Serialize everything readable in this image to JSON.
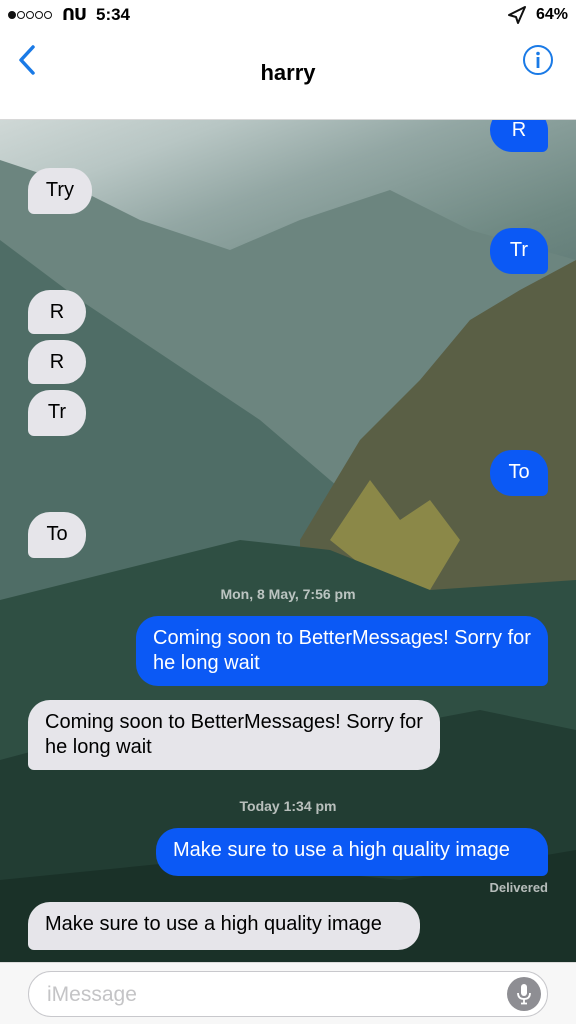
{
  "status_bar": {
    "carrier": "ᑎᑌ",
    "time": "5:34",
    "battery": "64%"
  },
  "nav": {
    "contact_name": "harry"
  },
  "messages": [
    {
      "text": "R",
      "dir": "out"
    },
    {
      "text": "Try",
      "dir": "in"
    },
    {
      "text": "Tr",
      "dir": "out"
    },
    {
      "text": "R",
      "dir": "in"
    },
    {
      "text": "R",
      "dir": "in"
    },
    {
      "text": "Tr",
      "dir": "in"
    },
    {
      "text": "To",
      "dir": "out"
    },
    {
      "text": "To",
      "dir": "in"
    },
    {
      "text": "Coming soon to BetterMessages! Sorry for he long wait",
      "dir": "out"
    },
    {
      "text": "Coming soon to BetterMessages! Sorry for he long wait",
      "dir": "in"
    },
    {
      "text": "Make sure to use a high quality image",
      "dir": "out"
    },
    {
      "text": "Make sure to use a high quality image",
      "dir": "in"
    }
  ],
  "timestamps": [
    "Mon, 8 May, 7:56 pm",
    "Today 1:34 pm"
  ],
  "delivered_label": "Delivered",
  "composer": {
    "placeholder": "iMessage"
  }
}
